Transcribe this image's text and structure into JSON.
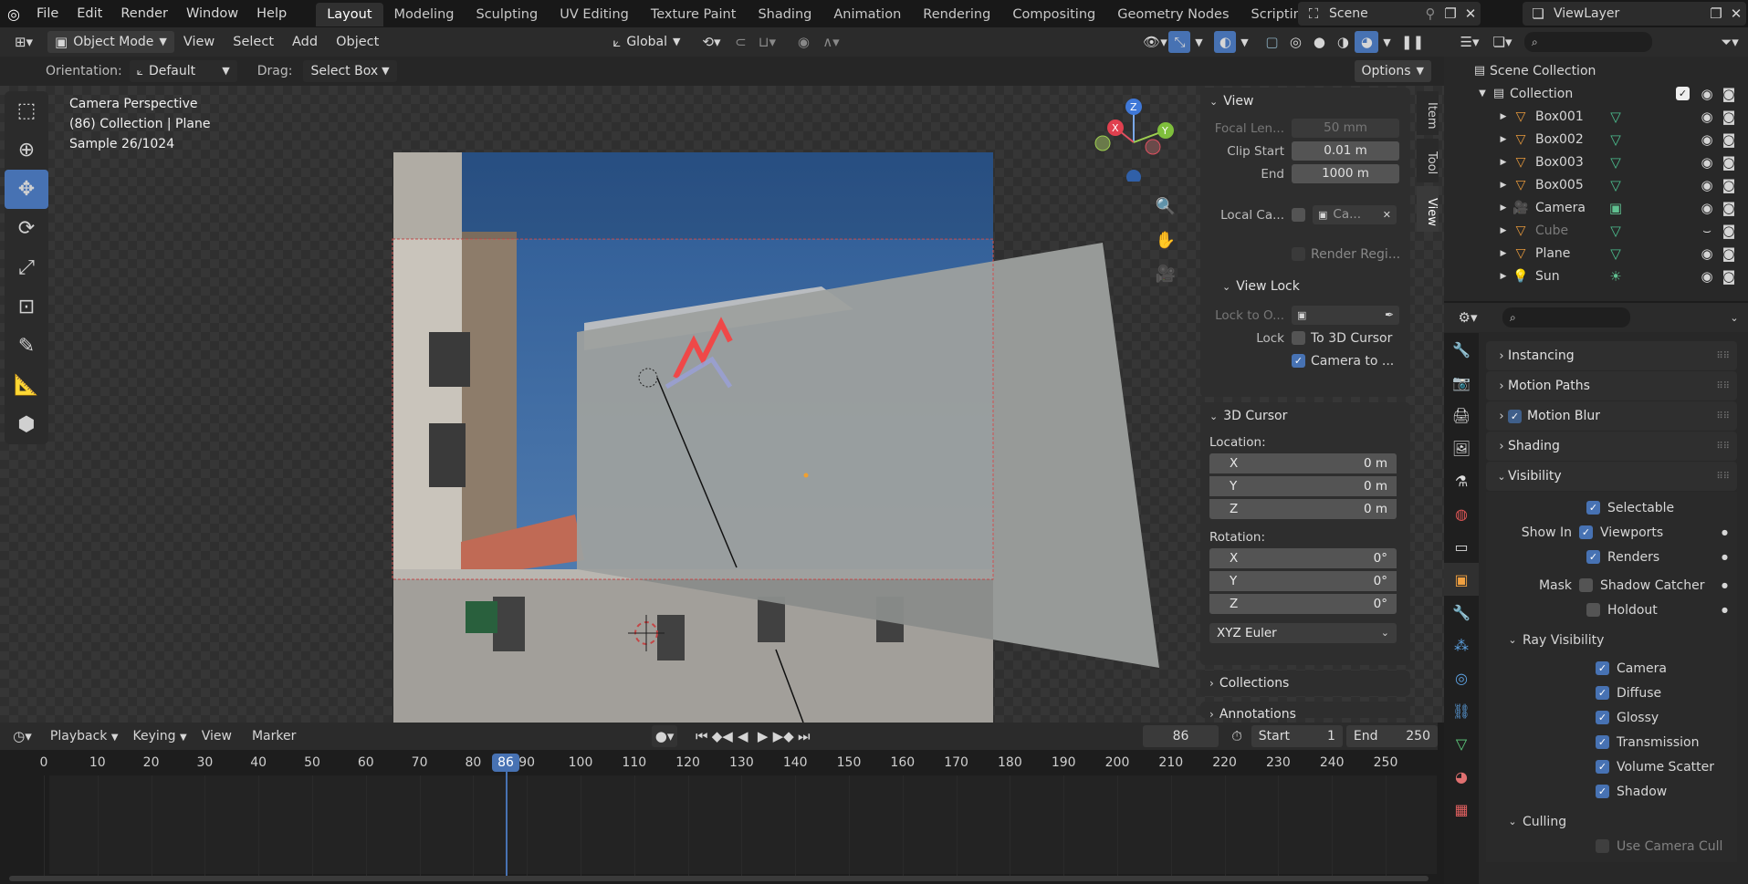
{
  "menu": [
    "File",
    "Edit",
    "Render",
    "Window",
    "Help"
  ],
  "workspaces": [
    "Layout",
    "Modeling",
    "Sculpting",
    "UV Editing",
    "Texture Paint",
    "Shading",
    "Animation",
    "Rendering",
    "Compositing",
    "Geometry Nodes",
    "Scripting"
  ],
  "active_workspace": "Layout",
  "scene": "Scene",
  "view_layer": "ViewLayer",
  "viewport_header": {
    "mode": "Object Mode",
    "menus": [
      "View",
      "Select",
      "Add",
      "Object"
    ],
    "transform": "Global",
    "options": "Options"
  },
  "tool_settings": {
    "orientation_label": "Orientation:",
    "orientation": "Default",
    "drag_label": "Drag:",
    "drag": "Select Box"
  },
  "overlay_text": {
    "line1": "Camera Perspective",
    "line2": "(86) Collection | Plane",
    "line3": "Sample 26/1024"
  },
  "gizmo": {
    "x": "X",
    "y": "Y",
    "z": "Z"
  },
  "npanel": {
    "tabs": [
      "Item",
      "Tool",
      "View"
    ],
    "view_title": "View",
    "focal_label": "Focal Len...",
    "focal_value": "50 mm",
    "clip_start_label": "Clip Start",
    "clip_start": "0.01 m",
    "end_label": "End",
    "end": "1000 m",
    "local_cam_label": "Local Ca...",
    "local_cam_value": "Ca...",
    "render_region": "Render Regi...",
    "view_lock_title": "View Lock",
    "lock_obj_label": "Lock to O...",
    "lock_label": "Lock",
    "to_cursor": "To 3D Cursor",
    "camera_to": "Camera to ...",
    "cursor_title": "3D Cursor",
    "location_label": "Location:",
    "loc": [
      {
        "axis": "X",
        "value": "0 m"
      },
      {
        "axis": "Y",
        "value": "0 m"
      },
      {
        "axis": "Z",
        "value": "0 m"
      }
    ],
    "rotation_label": "Rotation:",
    "rot": [
      {
        "axis": "X",
        "value": "0°"
      },
      {
        "axis": "Y",
        "value": "0°"
      },
      {
        "axis": "Z",
        "value": "0°"
      }
    ],
    "rot_mode": "XYZ Euler",
    "collections": "Collections",
    "annotations": "Annotations"
  },
  "outliner": {
    "root": "Scene Collection",
    "collection": "Collection",
    "items": [
      {
        "name": "Box001",
        "type": "mesh"
      },
      {
        "name": "Box002",
        "type": "mesh"
      },
      {
        "name": "Box003",
        "type": "mesh"
      },
      {
        "name": "Box005",
        "type": "mesh"
      },
      {
        "name": "Camera",
        "type": "camera"
      },
      {
        "name": "Cube",
        "type": "mesh",
        "hidden": true
      },
      {
        "name": "Plane",
        "type": "mesh"
      },
      {
        "name": "Sun",
        "type": "light"
      }
    ]
  },
  "properties": {
    "sections_collapsed": [
      "Instancing",
      "Motion Paths",
      "Motion Blur",
      "Shading"
    ],
    "visibility": "Visibility",
    "selectable": "Selectable",
    "show_in": "Show In",
    "viewports": "Viewports",
    "renders": "Renders",
    "mask": "Mask",
    "shadow_catcher": "Shadow Catcher",
    "holdout": "Holdout",
    "ray_visibility": "Ray Visibility",
    "rays": [
      "Camera",
      "Diffuse",
      "Glossy",
      "Transmission",
      "Volume Scatter",
      "Shadow"
    ],
    "culling": "Culling",
    "use_camera_cull": "Use Camera Cull"
  },
  "timeline": {
    "menus": [
      "Playback",
      "Keying",
      "View",
      "Marker"
    ],
    "current_frame": "86",
    "start_label": "Start",
    "start": "1",
    "end_label": "End",
    "end": "250",
    "ticks": [
      "0",
      "10",
      "20",
      "30",
      "40",
      "50",
      "60",
      "70",
      "80",
      "90",
      "100",
      "110",
      "120",
      "130",
      "140",
      "150",
      "160",
      "170",
      "180",
      "190",
      "200",
      "210",
      "220",
      "230",
      "240",
      "250"
    ],
    "playhead": "86"
  },
  "colors": {
    "accent": "#4772b3",
    "active_tool": "#4772b3",
    "playhead": "#4772b3",
    "mesh_icon": "#e89a3c",
    "sky": "#3f6fa8"
  }
}
